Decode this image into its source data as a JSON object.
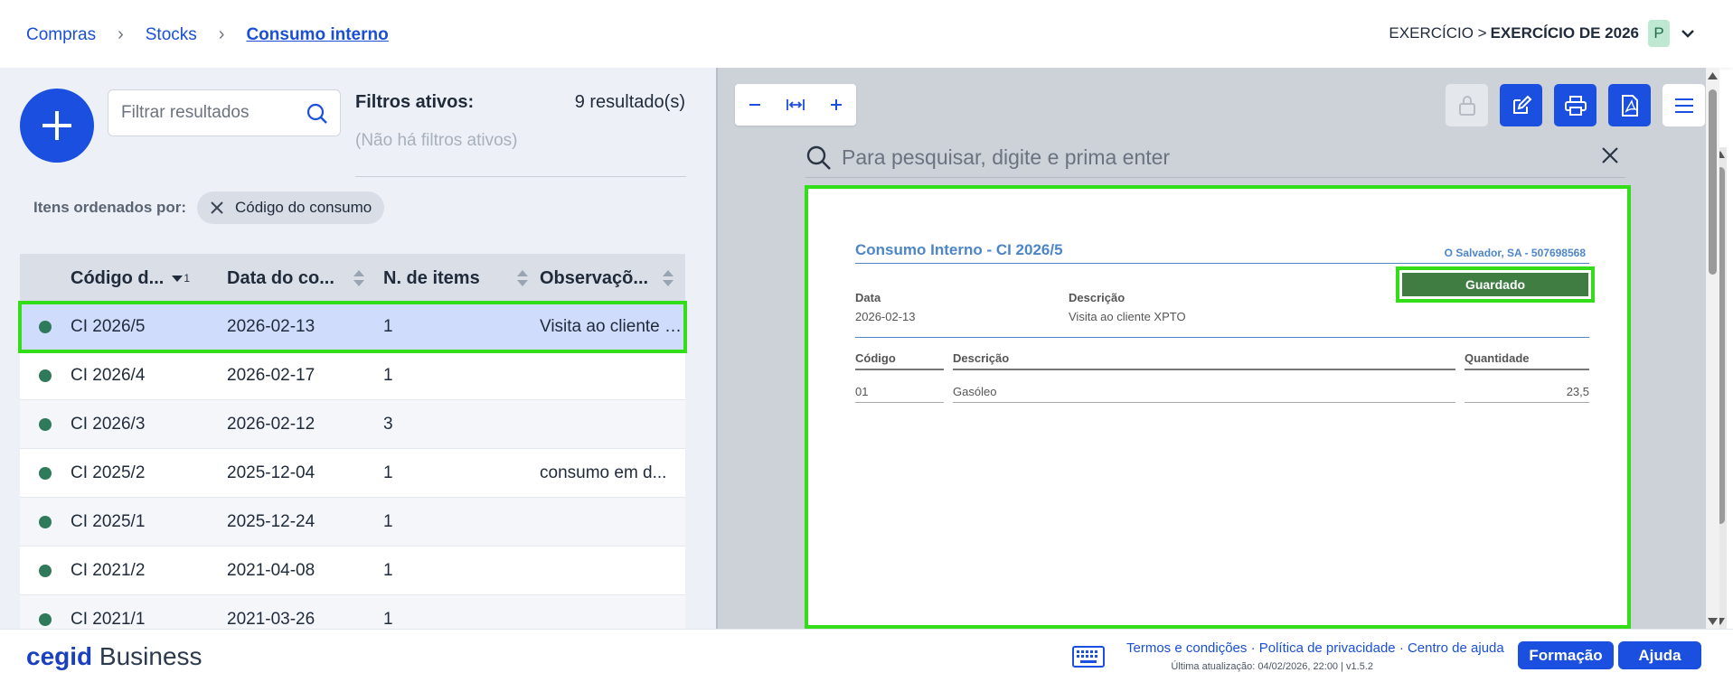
{
  "breadcrumb": {
    "items": [
      "Compras",
      "Stocks",
      "Consumo interno"
    ]
  },
  "exercise": {
    "label": "EXERCÍCIO >",
    "value": "EXERCÍCIO DE 2026",
    "avatar": "P"
  },
  "list": {
    "filter_placeholder": "Filtrar resultados",
    "filters_title": "Filtros ativos:",
    "filters_none": "(Não há filtros ativos)",
    "results": "9 resultado(s)",
    "sorted_label": "Itens ordenados por:",
    "sort_chip": "Código do consumo",
    "columns": [
      "Código d...",
      "Data do co...",
      "N. de items",
      "Observaçõ..."
    ],
    "sort_index": "1",
    "rows": [
      {
        "code": "CI 2026/5",
        "date": "2026-02-13",
        "items": "1",
        "obs": "Visita ao cliente XPTO"
      },
      {
        "code": "CI 2026/4",
        "date": "2026-02-17",
        "items": "1",
        "obs": ""
      },
      {
        "code": "CI 2026/3",
        "date": "2026-02-12",
        "items": "3",
        "obs": ""
      },
      {
        "code": "CI 2025/2",
        "date": "2025-12-04",
        "items": "1",
        "obs": "consumo em d..."
      },
      {
        "code": "CI 2025/1",
        "date": "2025-12-24",
        "items": "1",
        "obs": ""
      },
      {
        "code": "CI 2021/2",
        "date": "2021-04-08",
        "items": "1",
        "obs": ""
      },
      {
        "code": "CI 2021/1",
        "date": "2021-03-26",
        "items": "1",
        "obs": ""
      }
    ]
  },
  "viewer": {
    "search_placeholder": "Para pesquisar, digite e prima enter",
    "doc": {
      "title": "Consumo Interno - CI 2026/5",
      "company": "O Salvador, SA - 507698568",
      "status": "Guardado",
      "date_label": "Data",
      "date_value": "2026-02-13",
      "desc_label": "Descrição",
      "desc_value": "Visita ao cliente XPTO",
      "table_headers": [
        "Código",
        "Descrição",
        "Quantidade"
      ],
      "lines": [
        {
          "code": "01",
          "desc": "Gasóleo",
          "qty": "23,5"
        }
      ]
    }
  },
  "footer": {
    "brand_bold": "cegid",
    "brand_rest": "Business",
    "links": "Termos e condições · Política de privacidade · Centro de ajuda",
    "updated": "Última atualização: 04/02/2026, 22:00 | v1.5.2",
    "training": "Formação",
    "help": "Ajuda"
  },
  "colors": {
    "accent": "#1a4fe0",
    "status_green": "#3f7d43",
    "highlight": "#33dd1a"
  }
}
